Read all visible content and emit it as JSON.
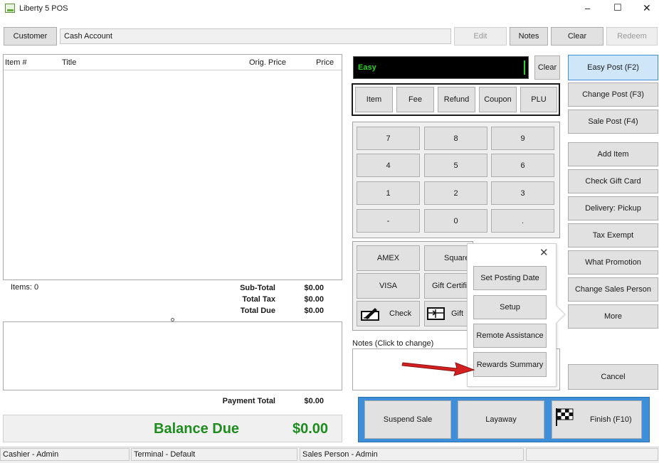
{
  "window": {
    "title": "Liberty 5 POS",
    "minimize": "–",
    "maximize": "☐",
    "close": "✕"
  },
  "topbar": {
    "customer": "Customer",
    "account": "Cash Account",
    "edit": "Edit",
    "notes": "Notes",
    "clear": "Clear",
    "redeem": "Redeem"
  },
  "items_table": {
    "columns": [
      "Item #",
      "Title",
      "Orig. Price",
      "Price"
    ],
    "items_count": "Items: 0"
  },
  "totals": {
    "subtotal_label": "Sub-Total",
    "subtotal": "$0.00",
    "tax_label": "Total Tax",
    "tax": "$0.00",
    "due_label": "Total Due",
    "due": "$0.00",
    "payment_label": "Payment Total",
    "payment": "$0.00",
    "balance_label": "Balance Due",
    "balance": "$0.00"
  },
  "entry": {
    "mode": "Easy",
    "clear": "Clear"
  },
  "entry_types": [
    "Item",
    "Fee",
    "Refund",
    "Coupon",
    "PLU"
  ],
  "keypad": [
    "7",
    "8",
    "9",
    "4",
    "5",
    "6",
    "1",
    "2",
    "3",
    "-",
    "0",
    "."
  ],
  "payments": {
    "amex": "AMEX",
    "square": "Square",
    "visa": "VISA",
    "gift_cert": "Gift Certifi",
    "check": "Check",
    "gift": "Gift"
  },
  "notes_label": "Notes (Click to change)",
  "popup": {
    "close": "✕",
    "items": [
      "Set Posting Date",
      "Setup",
      "Remote Assistance",
      "Rewards Summary"
    ]
  },
  "right_buttons": [
    "Easy Post (F2)",
    "Change Post (F3)",
    "Sale Post (F4)",
    "Add Item",
    "Check Gift Card",
    "Delivery: Pickup",
    "Tax Exempt",
    "What Promotion",
    "Change Sales Person",
    "More"
  ],
  "cancel": "Cancel",
  "bottom_actions": {
    "suspend": "Suspend Sale",
    "layaway": "Layaway",
    "finish": "Finish (F10)"
  },
  "status": {
    "cashier": "Cashier - Admin",
    "terminal": "Terminal - Default",
    "salesperson": "Sales Person - Admin"
  },
  "colors": {
    "accent": "#1e8c1e",
    "entry_bg": "#000000",
    "easy_text": "#2fd12f",
    "highlight_bg": "#cfe6f8",
    "highlight_border": "#3c8fd8",
    "bottom_panel": "#3c8fd8",
    "arrow": "#d42020"
  }
}
